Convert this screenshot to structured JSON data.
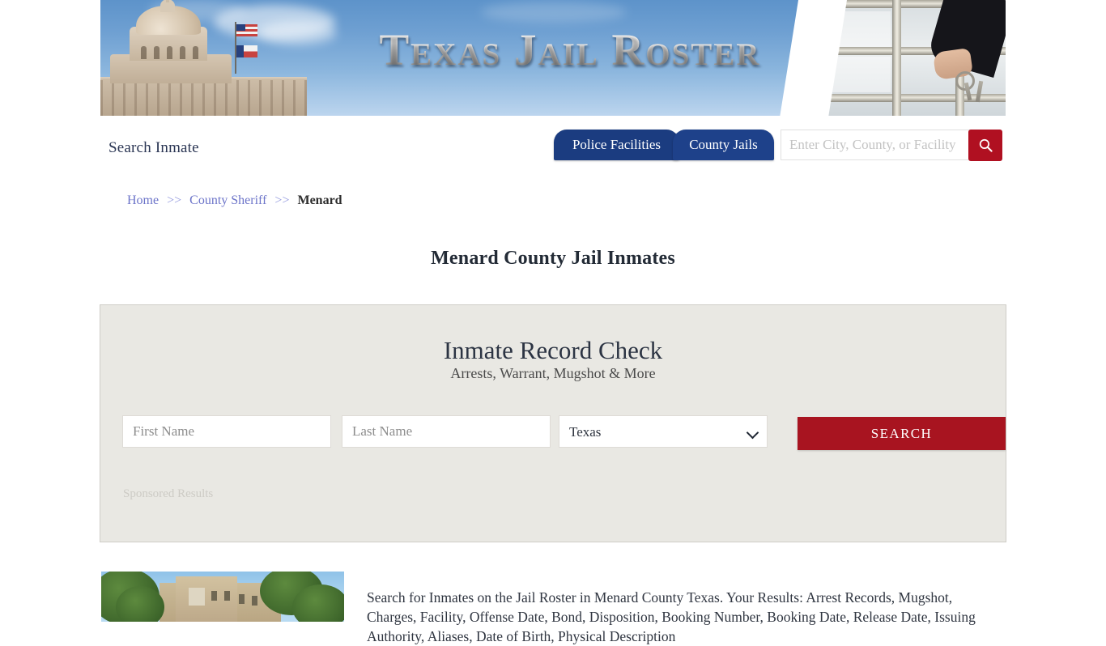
{
  "site": {
    "banner_title": "Texas Jail Roster"
  },
  "header": {
    "search_inmate_label": "Search Inmate",
    "tabs": [
      {
        "label": "Police Facilities"
      },
      {
        "label": "County Jails"
      }
    ],
    "search": {
      "placeholder": "Enter City, County, or Facility",
      "value": "",
      "button_icon": "search-icon"
    }
  },
  "breadcrumb": {
    "items": [
      {
        "label": "Home",
        "type": "link"
      },
      {
        "label": "County Sheriff",
        "type": "link"
      },
      {
        "label": "Menard",
        "type": "current"
      }
    ],
    "separator": ">>"
  },
  "page": {
    "title": "Menard County Jail Inmates"
  },
  "ad_panel": {
    "heading": "Inmate Record Check",
    "subheading": "Arrests, Warrant, Mugshot & More",
    "first_name": {
      "placeholder": "First Name",
      "value": ""
    },
    "last_name": {
      "placeholder": "Last Name",
      "value": ""
    },
    "state_select": {
      "selected": "Texas",
      "options": [
        "Texas"
      ]
    },
    "search_button": "SEARCH",
    "sponsored_label": "Sponsored Results"
  },
  "content": {
    "photo_alt": "Menard County Jail building",
    "paragraph": "Search for Inmates on the Jail Roster in Menard County Texas. Your Results: Arrest Records, Mugshot, Charges, Facility, Offense Date, Bond, Disposition, Booking Number, Booking Date, Release Date, Issuing Authority, Aliases, Date of Birth, Physical Description"
  },
  "colors": {
    "navy": "#1b3c80",
    "crimson": "#a81420",
    "panel_bg": "#e9e8e3",
    "link": "#6c74c9"
  }
}
